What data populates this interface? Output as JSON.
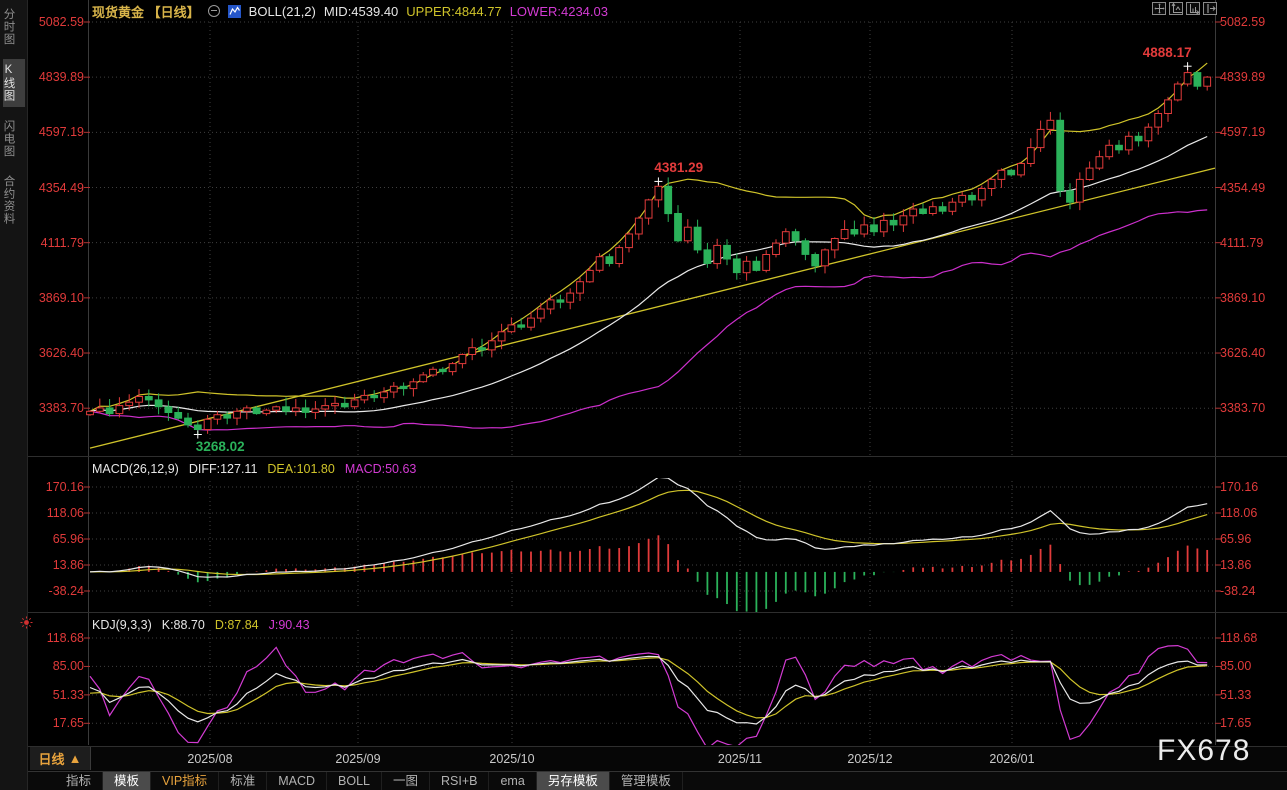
{
  "header": {
    "title": "现货黄金",
    "period": "【日线】",
    "boll_label": "BOLL(21,2)",
    "mid": "MID:4539.40",
    "upper": "UPPER:4844.77",
    "lower": "LOWER:4234.03"
  },
  "sidebar": {
    "items": [
      {
        "label": "分时图",
        "selected": false
      },
      {
        "label": "K线图",
        "selected": true
      },
      {
        "label": "闪电图",
        "selected": false
      },
      {
        "label": "合约资料",
        "selected": false
      }
    ]
  },
  "toolbar": {
    "icons": [
      "crosshair-icon",
      "axis-zoom-icon",
      "axis-pan-icon",
      "exit-chart-icon"
    ]
  },
  "macd_header": {
    "label": "MACD(26,12,9)",
    "diff": "DIFF:127.11",
    "dea": "DEA:101.80",
    "macd": "MACD:50.63"
  },
  "kdj_header": {
    "label": "KDJ(9,3,3)",
    "k": "K:88.70",
    "d": "D:87.84",
    "j": "J:90.43"
  },
  "xaxis": {
    "period_label": "日线",
    "arrow": "▲",
    "months": [
      "2025/08",
      "2025/09",
      "2025/10",
      "2025/11",
      "2025/12",
      "2026/01"
    ]
  },
  "watermark": "FX678",
  "tabs": [
    {
      "label": "指标",
      "state": "normal"
    },
    {
      "label": "模板",
      "state": "active"
    },
    {
      "label": "VIP指标",
      "state": "vip"
    },
    {
      "label": "标准",
      "state": "normal"
    },
    {
      "label": "MACD",
      "state": "normal"
    },
    {
      "label": "BOLL",
      "state": "normal"
    },
    {
      "label": "一图",
      "state": "normal"
    },
    {
      "label": "RSI+B",
      "state": "normal"
    },
    {
      "label": "ema",
      "state": "normal"
    },
    {
      "label": "另存模板",
      "state": "active"
    },
    {
      "label": "管理模板",
      "state": "normal"
    }
  ],
  "colors": {
    "up": "#e23b3b",
    "down": "#2bb25a",
    "axis_text": "#e03a3a",
    "yellow": "#cfc32a",
    "magenta": "#d33bd3",
    "white_line": "#e8e8e8",
    "grid": "#3f3f3f",
    "tick_dash": "#b23333"
  },
  "chart_data": {
    "type": "candlestick",
    "title": "现货黄金 日线 (Spot Gold Daily)",
    "x_labels": [
      "2025/08",
      "2025/09",
      "2025/10",
      "2025/11",
      "2025/12",
      "2026/01"
    ],
    "y_ticks": [
      5082.59,
      4839.89,
      4597.19,
      4354.49,
      4111.79,
      3869.1,
      3626.4,
      3383.7
    ],
    "closes": [
      3370,
      3385,
      3360,
      3395,
      3410,
      3435,
      3420,
      3390,
      3365,
      3340,
      3310,
      3290,
      3335,
      3355,
      3340,
      3370,
      3385,
      3360,
      3375,
      3390,
      3370,
      3385,
      3365,
      3380,
      3395,
      3405,
      3390,
      3420,
      3440,
      3430,
      3455,
      3480,
      3470,
      3500,
      3530,
      3555,
      3545,
      3580,
      3620,
      3650,
      3640,
      3680,
      3720,
      3750,
      3740,
      3780,
      3820,
      3860,
      3850,
      3890,
      3940,
      3990,
      4050,
      4020,
      4090,
      4150,
      4220,
      4300,
      4360,
      4240,
      4120,
      4180,
      4080,
      4020,
      4100,
      4040,
      3980,
      4030,
      3990,
      4060,
      4110,
      4160,
      4120,
      4060,
      4010,
      4080,
      4130,
      4170,
      4150,
      4190,
      4160,
      4210,
      4190,
      4230,
      4260,
      4240,
      4270,
      4250,
      4290,
      4320,
      4300,
      4350,
      4390,
      4430,
      4410,
      4460,
      4530,
      4610,
      4650,
      4340,
      4290,
      4390,
      4440,
      4490,
      4540,
      4520,
      4580,
      4560,
      4620,
      4680,
      4740,
      4810,
      4860,
      4800,
      4840
    ],
    "marked_points": [
      {
        "index": 11,
        "type": "low",
        "price": 3268.02,
        "label": "3268.02",
        "color": "#2bb25a"
      },
      {
        "index": 58,
        "type": "high",
        "price": 4381.29,
        "label": "4381.29",
        "color": "#e23b3b"
      },
      {
        "index": 112,
        "type": "high",
        "price": 4888.17,
        "label": "4888.17",
        "color": "#e23b3b"
      }
    ],
    "trendline": {
      "from_price": 3208,
      "to_price": 4440,
      "color": "#cfc32a"
    },
    "indicators": {
      "boll": {
        "params": "21,2",
        "mid": 4539.4,
        "upper": 4844.77,
        "lower": 4234.03
      },
      "macd": {
        "params": "26,12,9",
        "diff": 127.11,
        "dea": 101.8,
        "macd": 50.63,
        "y_ticks": [
          170.16,
          118.06,
          65.96,
          13.86,
          -38.24
        ]
      },
      "kdj": {
        "params": "9,3,3",
        "k": 88.7,
        "d": 87.84,
        "j": 90.43,
        "y_ticks": [
          118.68,
          85.0,
          51.33,
          17.65
        ]
      }
    }
  }
}
